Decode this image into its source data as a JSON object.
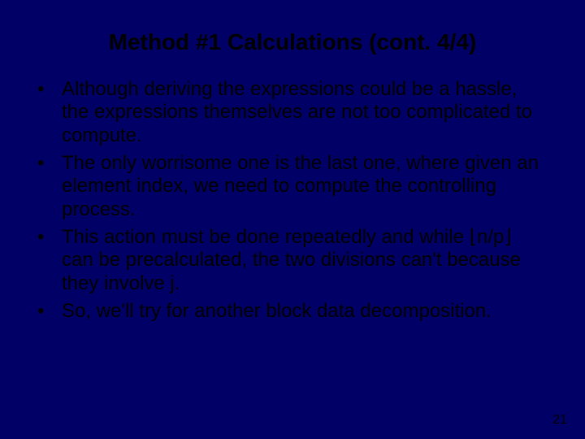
{
  "slide": {
    "title": "Method #1 Calculations (cont. 4/4)",
    "bullets": [
      "Although deriving the expressions could be a hassle, the expressions themselves are not too complicated to compute.",
      "The only worrisome one is the last one, where given an element index, we need to compute the controlling process.",
      "This action must be done repeatedly and while ⌊n/p⌋ can be precalculated, the two divisions can't because they involve j.",
      "So, we'll try for another block data decomposition."
    ],
    "page_number": "21"
  }
}
